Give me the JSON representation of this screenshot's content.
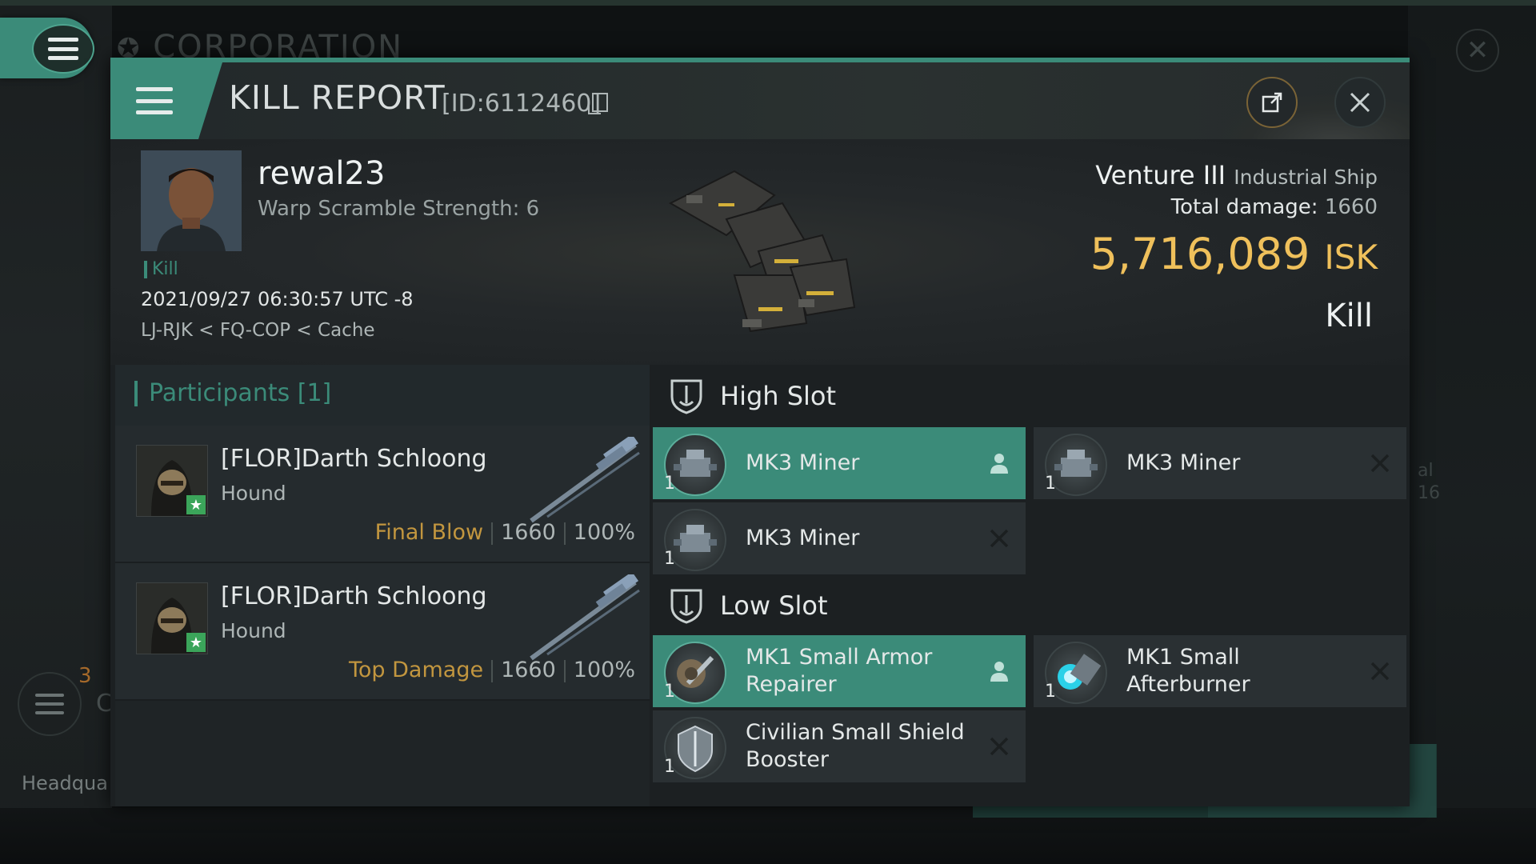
{
  "background": {
    "corporation_label": "CORPORATION",
    "badge_count": "3",
    "side_letter": "C",
    "headquarters_label": "Headqua",
    "right_fragment_1": "al",
    "right_fragment_2": "16"
  },
  "header": {
    "title": "KILL REPORT",
    "report_id": "[ID:6112460]"
  },
  "victim": {
    "name": "rewal23",
    "warp_scramble": "Warp Scramble Strength: 6",
    "tag": "Kill",
    "datetime": "2021/09/27 06:30:57 UTC -8",
    "location": "LJ-RJK < FQ-COP < Cache",
    "ship_name": "Venture III",
    "ship_class": "Industrial Ship",
    "total_damage_label": "Total damage:",
    "total_damage": "1660",
    "isk_value": "5,716,089",
    "isk_unit": "ISK",
    "kill_type": "Kill"
  },
  "participants": {
    "title": "Participants [1]",
    "rows": [
      {
        "name": "[FLOR]Darth Schloong",
        "ship": "Hound",
        "tag": "Final Blow",
        "damage": "1660",
        "percent": "100%"
      },
      {
        "name": "[FLOR]Darth Schloong",
        "ship": "Hound",
        "tag": "Top Damage",
        "damage": "1660",
        "percent": "100%"
      }
    ]
  },
  "slots": {
    "high_title": "High Slot",
    "low_title": "Low Slot",
    "high": [
      {
        "name": "MK3 Miner",
        "qty": "1",
        "state": "fitted"
      },
      {
        "name": "MK3 Miner",
        "qty": "1",
        "state": "destroyed"
      },
      {
        "name": "MK3 Miner",
        "qty": "1",
        "state": "destroyed"
      }
    ],
    "low": [
      {
        "name": "MK1 Small Armor Repairer",
        "qty": "1",
        "state": "fitted"
      },
      {
        "name": "MK1 Small Afterburner",
        "qty": "1",
        "state": "destroyed"
      },
      {
        "name": "Civilian Small Shield Booster",
        "qty": "1",
        "state": "destroyed"
      }
    ]
  },
  "colors": {
    "accent": "#3b8b79",
    "isk": "#efc05b",
    "tag_gold": "#c2963f"
  }
}
